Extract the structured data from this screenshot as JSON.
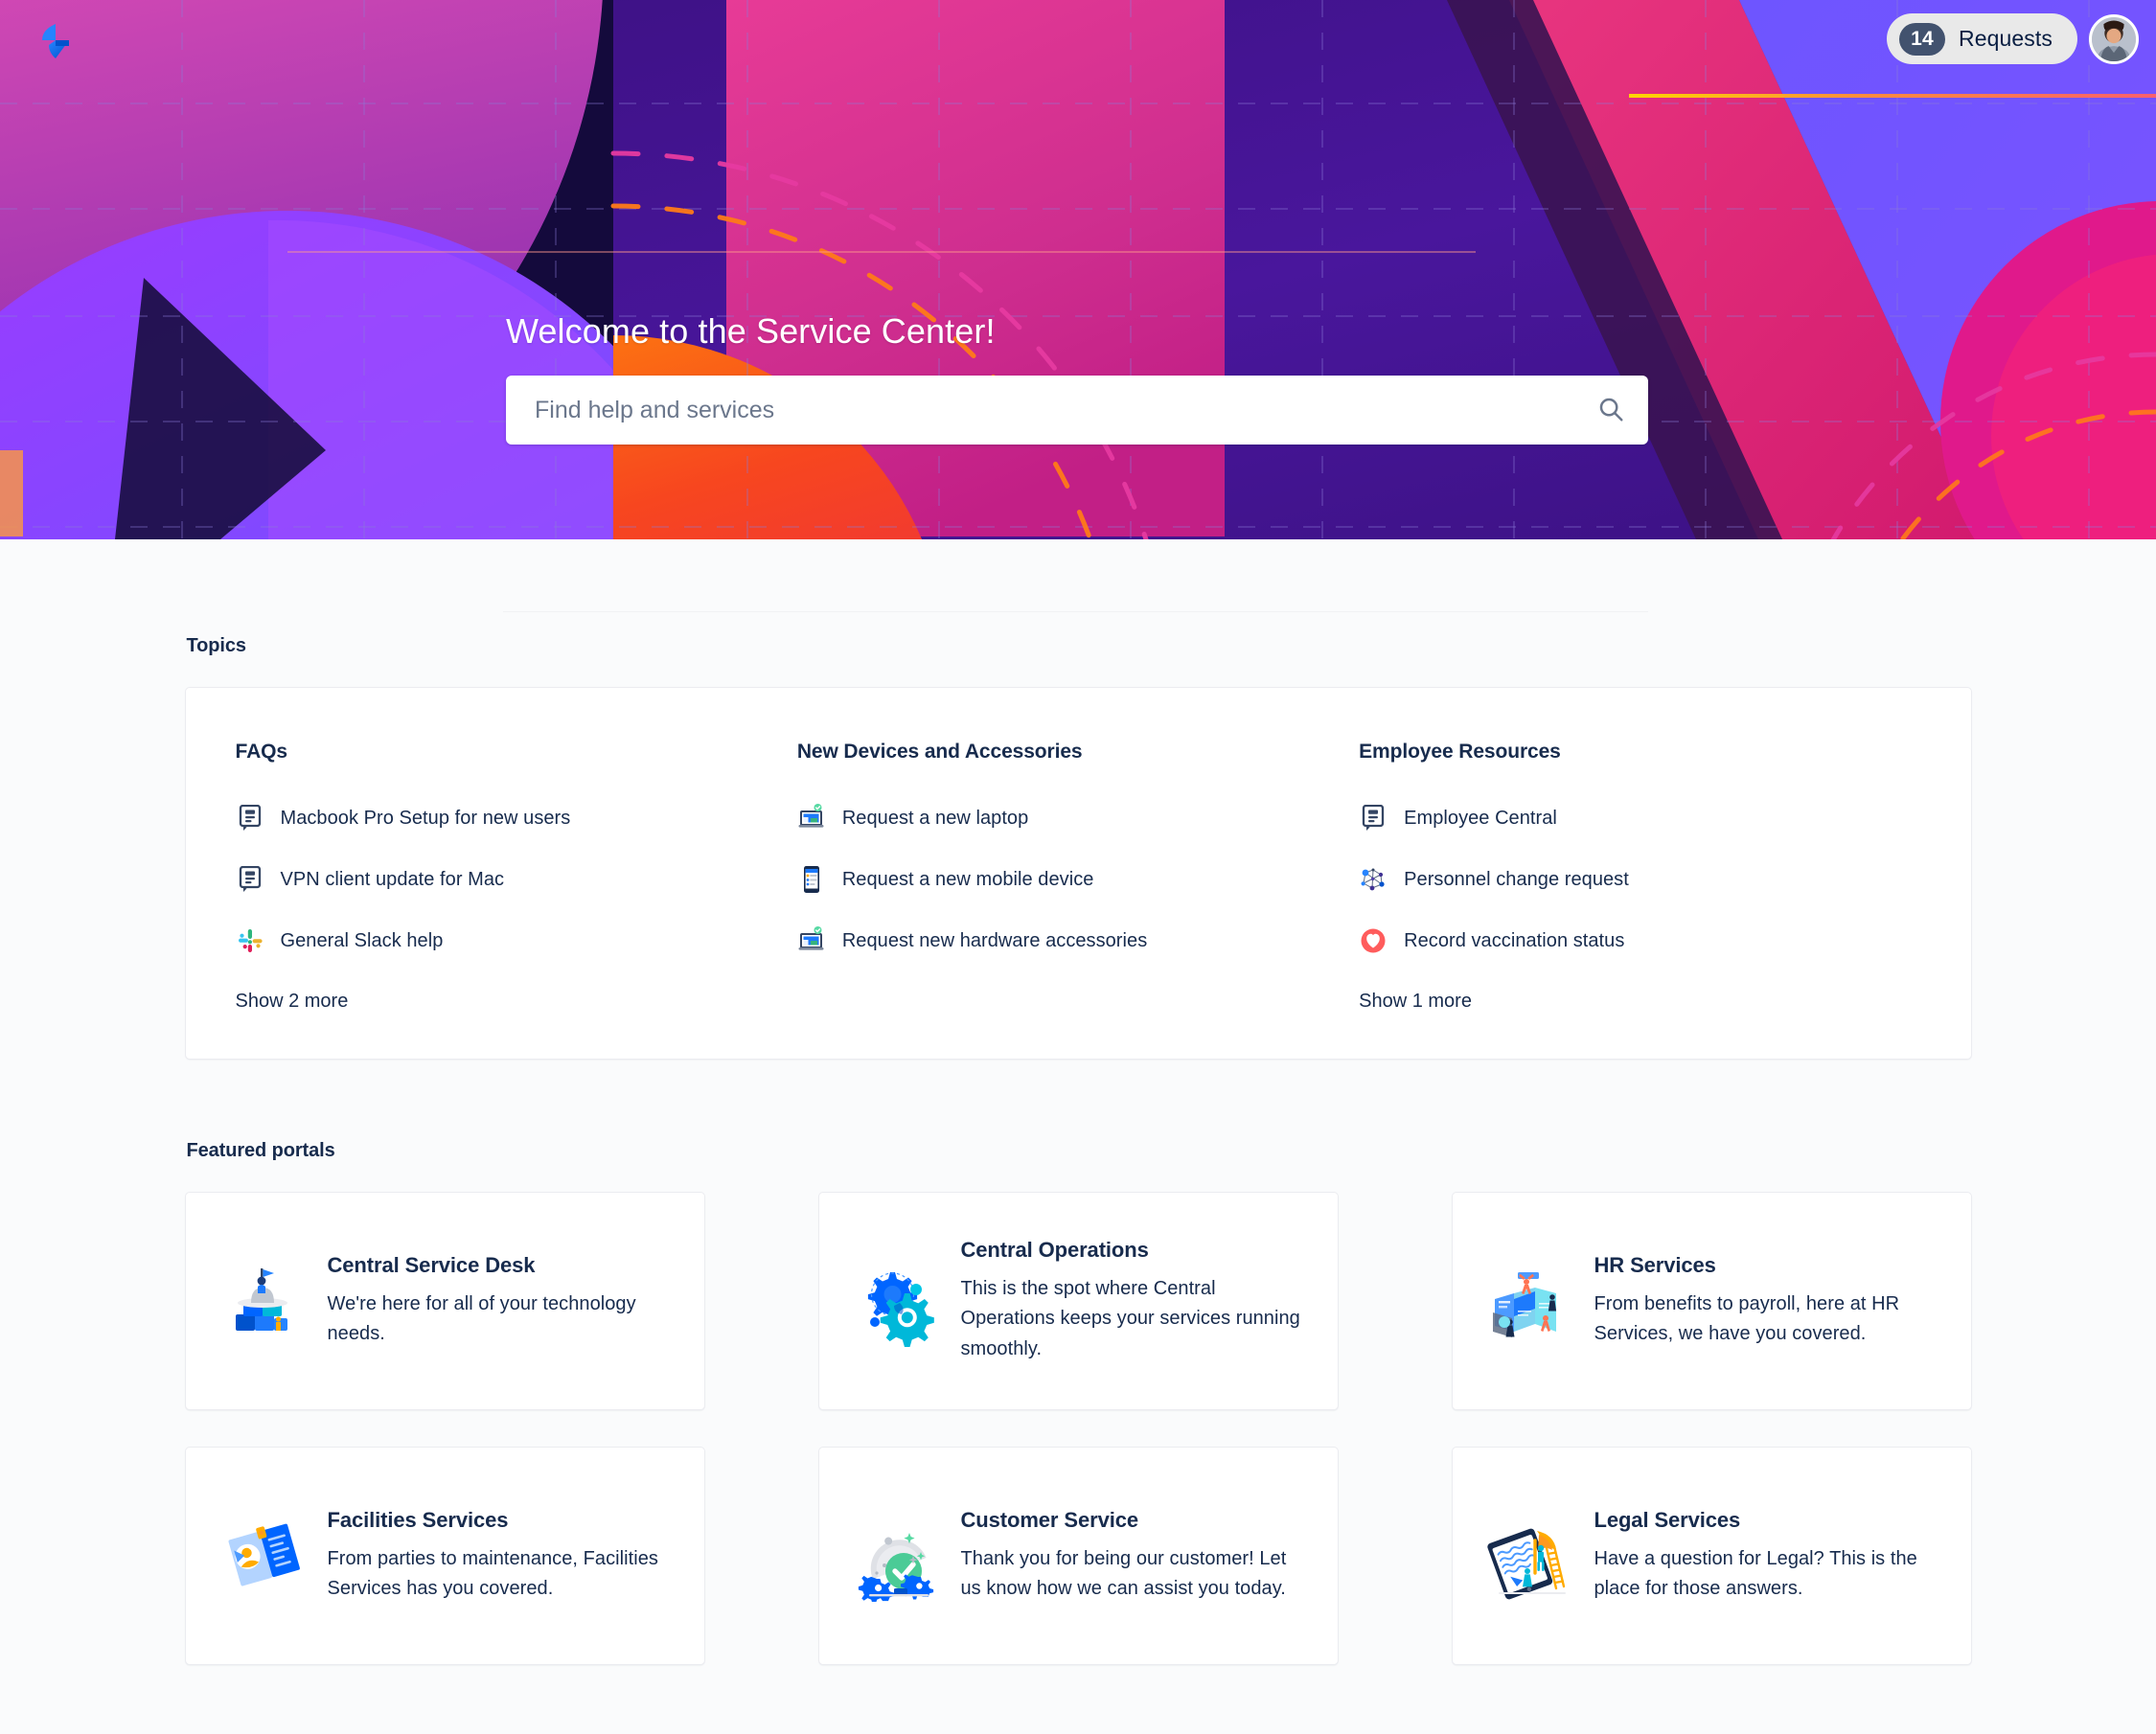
{
  "brand": {
    "logo_icon": "jira-service-management-lightning-logo",
    "accent_color": "#2684ff",
    "hero_bg_colors": [
      "#2a1060",
      "#7a2bd6",
      "#e2318d",
      "#f03a3a",
      "#ff7a18",
      "#6554ff"
    ]
  },
  "header": {
    "requests_count": "14",
    "requests_label": "Requests",
    "avatar_icon": "user-avatar"
  },
  "hero": {
    "title": "Welcome to the Service Center!",
    "search_placeholder": "Find help and services",
    "search_value": "",
    "search_icon": "search-icon"
  },
  "topics": {
    "heading": "Topics",
    "columns": [
      {
        "title": "FAQs",
        "items": [
          {
            "label": "Macbook Pro Setup for new users",
            "icon": "knowledge-article-icon"
          },
          {
            "label": "VPN client update for Mac",
            "icon": "knowledge-article-icon"
          },
          {
            "label": "General Slack help",
            "icon": "slack-icon"
          }
        ],
        "show_more": "Show 2 more"
      },
      {
        "title": "New Devices and Accessories",
        "items": [
          {
            "label": "Request a new laptop",
            "icon": "laptop-icon"
          },
          {
            "label": "Request a new mobile device",
            "icon": "mobile-device-icon"
          },
          {
            "label": "Request new hardware accessories",
            "icon": "laptop-icon"
          }
        ],
        "show_more": ""
      },
      {
        "title": "Employee Resources",
        "items": [
          {
            "label": "Employee Central",
            "icon": "knowledge-article-icon"
          },
          {
            "label": "Personnel change request",
            "icon": "network-nodes-icon"
          },
          {
            "label": "Record vaccination status",
            "icon": "heart-shield-icon"
          }
        ],
        "show_more": "Show 1 more"
      }
    ]
  },
  "featured": {
    "heading": "Featured portals",
    "portals": [
      {
        "title": "Central Service Desk",
        "description": "We're here for all of your technology needs.",
        "icon": "service-desk-blocks-illustration"
      },
      {
        "title": "Central Operations",
        "description": "This is the spot where Central Operations keeps your services running smoothly.",
        "icon": "gears-illustration"
      },
      {
        "title": "HR Services",
        "description": "From benefits to payroll, here at HR Services, we have you covered.",
        "icon": "hr-people-panels-illustration"
      },
      {
        "title": "Facilities Services",
        "description": "From parties to maintenance, Facilities Services has you covered.",
        "icon": "facilities-badge-illustration"
      },
      {
        "title": "Customer Service",
        "description": "Thank you for being our customer! Let us know how we can assist you today.",
        "icon": "customer-service-dome-illustration"
      },
      {
        "title": "Legal Services",
        "description": "Have a question for Legal? This is the place for those answers.",
        "icon": "legal-quill-tablet-illustration"
      }
    ]
  }
}
